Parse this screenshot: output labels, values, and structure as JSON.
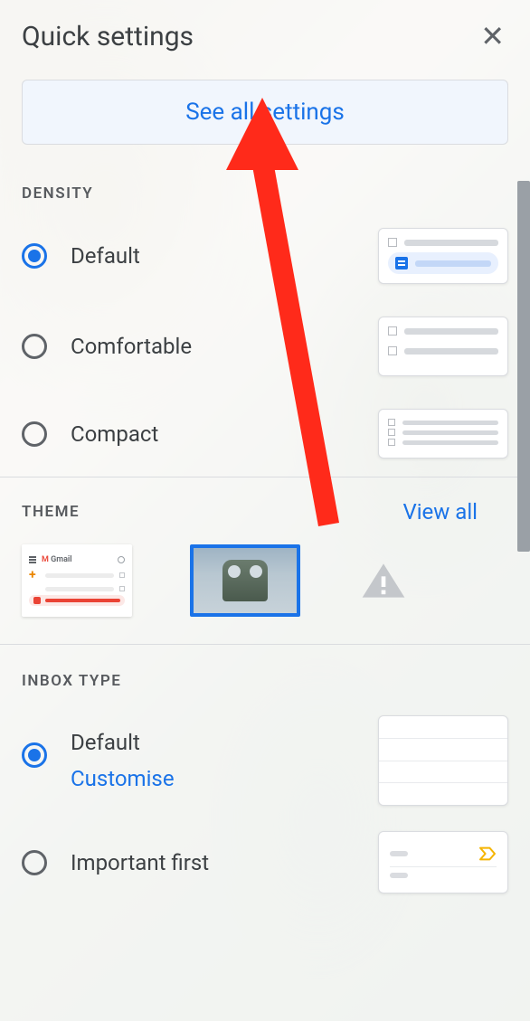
{
  "header": {
    "title": "Quick settings"
  },
  "buttons": {
    "see_all": "See all settings"
  },
  "sections": {
    "density": {
      "heading": "DENSITY",
      "options": {
        "default": "Default",
        "comfortable": "Comfortable",
        "compact": "Compact"
      }
    },
    "theme": {
      "heading": "THEME",
      "view_all": "View all"
    },
    "inbox_type": {
      "heading": "INBOX TYPE",
      "default_label": "Default",
      "customise": "Customise",
      "important_first": "Important first"
    }
  }
}
